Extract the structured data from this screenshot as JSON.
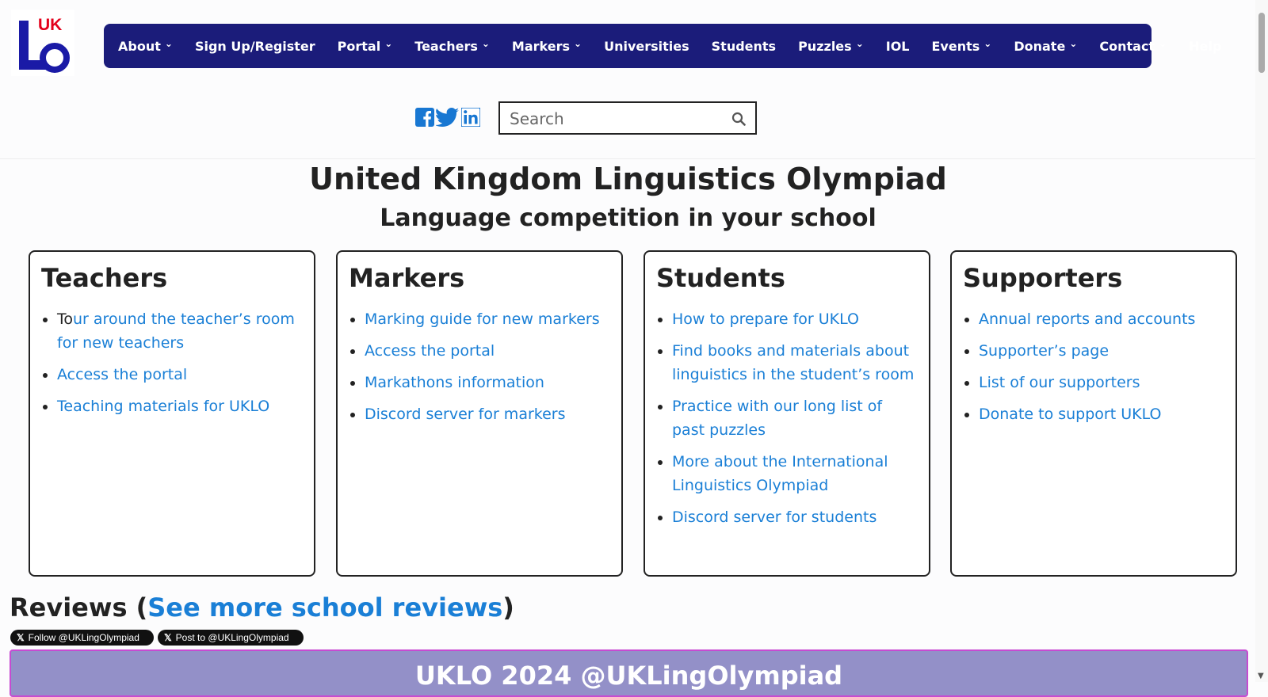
{
  "logo": {
    "text": "UK"
  },
  "nav": {
    "items": [
      {
        "label": "About",
        "has_dropdown": true
      },
      {
        "label": "Sign Up/Register",
        "has_dropdown": false
      },
      {
        "label": "Portal",
        "has_dropdown": true
      },
      {
        "label": "Teachers",
        "has_dropdown": true
      },
      {
        "label": "Markers",
        "has_dropdown": true
      },
      {
        "label": "Universities",
        "has_dropdown": false
      },
      {
        "label": "Students",
        "has_dropdown": false
      },
      {
        "label": "Puzzles",
        "has_dropdown": true
      },
      {
        "label": "IOL",
        "has_dropdown": false
      },
      {
        "label": "Events",
        "has_dropdown": true
      },
      {
        "label": "Donate",
        "has_dropdown": true
      },
      {
        "label": "Contact",
        "has_dropdown": true
      },
      {
        "label": "Help",
        "has_dropdown": false
      }
    ]
  },
  "social": {
    "icons": [
      "facebook-icon",
      "twitter-icon",
      "linkedin-icon"
    ],
    "colors": {
      "facebook": "#1877d2",
      "twitter": "#1877d2",
      "linkedin": "#1877d2"
    }
  },
  "search": {
    "placeholder": "Search"
  },
  "hero": {
    "title": "United Kingdom Linguistics Olympiad",
    "subtitle": "Language competition in your school"
  },
  "cards": [
    {
      "heading": "Teachers",
      "links": [
        {
          "prefix": "To",
          "text": "ur around the teacher’s room for new teachers"
        },
        {
          "prefix": "",
          "text": "Access the portal"
        },
        {
          "prefix": "",
          "text": "Teaching materials for UKLO"
        }
      ]
    },
    {
      "heading": "Markers",
      "links": [
        {
          "prefix": "",
          "text": "Marking guide for new markers"
        },
        {
          "prefix": "",
          "text": "Access the portal"
        },
        {
          "prefix": "",
          "text": "Markathons information"
        },
        {
          "prefix": "",
          "text": "Discord server for markers"
        }
      ]
    },
    {
      "heading": "Students",
      "links": [
        {
          "prefix": "",
          "text": "How to prepare for UKLO"
        },
        {
          "prefix": "",
          "text": "Find books and materials about linguistics in the student’s room"
        },
        {
          "prefix": "",
          "text": "Practice with our long list of past puzzles"
        },
        {
          "prefix": "",
          "text": "More about the International Linguistics Olympiad"
        },
        {
          "prefix": "",
          "text": "Discord server for students"
        }
      ]
    },
    {
      "heading": "Supporters",
      "links": [
        {
          "prefix": "",
          "text": "Annual reports and accounts"
        },
        {
          "prefix": "",
          "text": "Supporter’s page"
        },
        {
          "prefix": "",
          "text": "List of our supporters"
        },
        {
          "prefix": "",
          "text": "Donate to support UKLO"
        }
      ]
    }
  ],
  "reviews": {
    "label": "Reviews (",
    "link": "See more school reviews",
    "close": ")"
  },
  "twitter_buttons": {
    "follow": "Follow @UKLingOlympiad",
    "post": "Post to @UKLingOlympiad"
  },
  "banner": {
    "text": "UKLO 2024 @UKLingOlympiad"
  },
  "colors": {
    "nav_bg": "#1b1c7a",
    "link": "#1a7fd6",
    "banner_bg": "#9390c8",
    "banner_border": "#c74bd1",
    "logo_red": "#e3001b",
    "logo_blue": "#1a1aa6"
  }
}
